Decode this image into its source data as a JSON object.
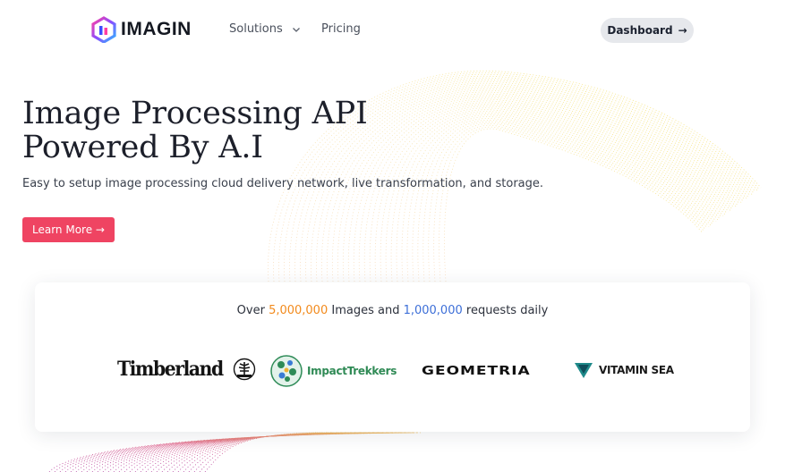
{
  "header": {
    "logo": {
      "text": "IMAGIN",
      "icon": "imagin-logo-icon"
    },
    "nav": [
      {
        "label": "Solutions",
        "icon": "chevron-down-icon"
      },
      {
        "label": "Pricing"
      }
    ],
    "dashboard_button": {
      "label": "Dashboard",
      "arrow": "→"
    }
  },
  "hero": {
    "title_line1": "Image Processing API",
    "title_line2": "Powered By A.I",
    "subtitle": "Easy to setup image processing cloud delivery network, live transformation, and storage.",
    "cta_label": "Learn More →"
  },
  "stats": {
    "prefix": "Over ",
    "images_count": "5,000,000",
    "middle": " Images and ",
    "requests_count": "1,000,000",
    "suffix": " requests daily"
  },
  "partners": [
    {
      "name": "Timberland",
      "icon": "tree-icon"
    },
    {
      "name": "ImpactTrekkers",
      "icon": "globe-icon"
    },
    {
      "name": "GEOMETRIA",
      "icon": ""
    },
    {
      "name": "VITAMIN SEA",
      "icon": "triangle-icon"
    }
  ],
  "colors": {
    "accent": "#ef4462",
    "orange": "#f28a1c",
    "blue": "#3d6fd8",
    "dashboard_bg": "#e6e8ec"
  }
}
